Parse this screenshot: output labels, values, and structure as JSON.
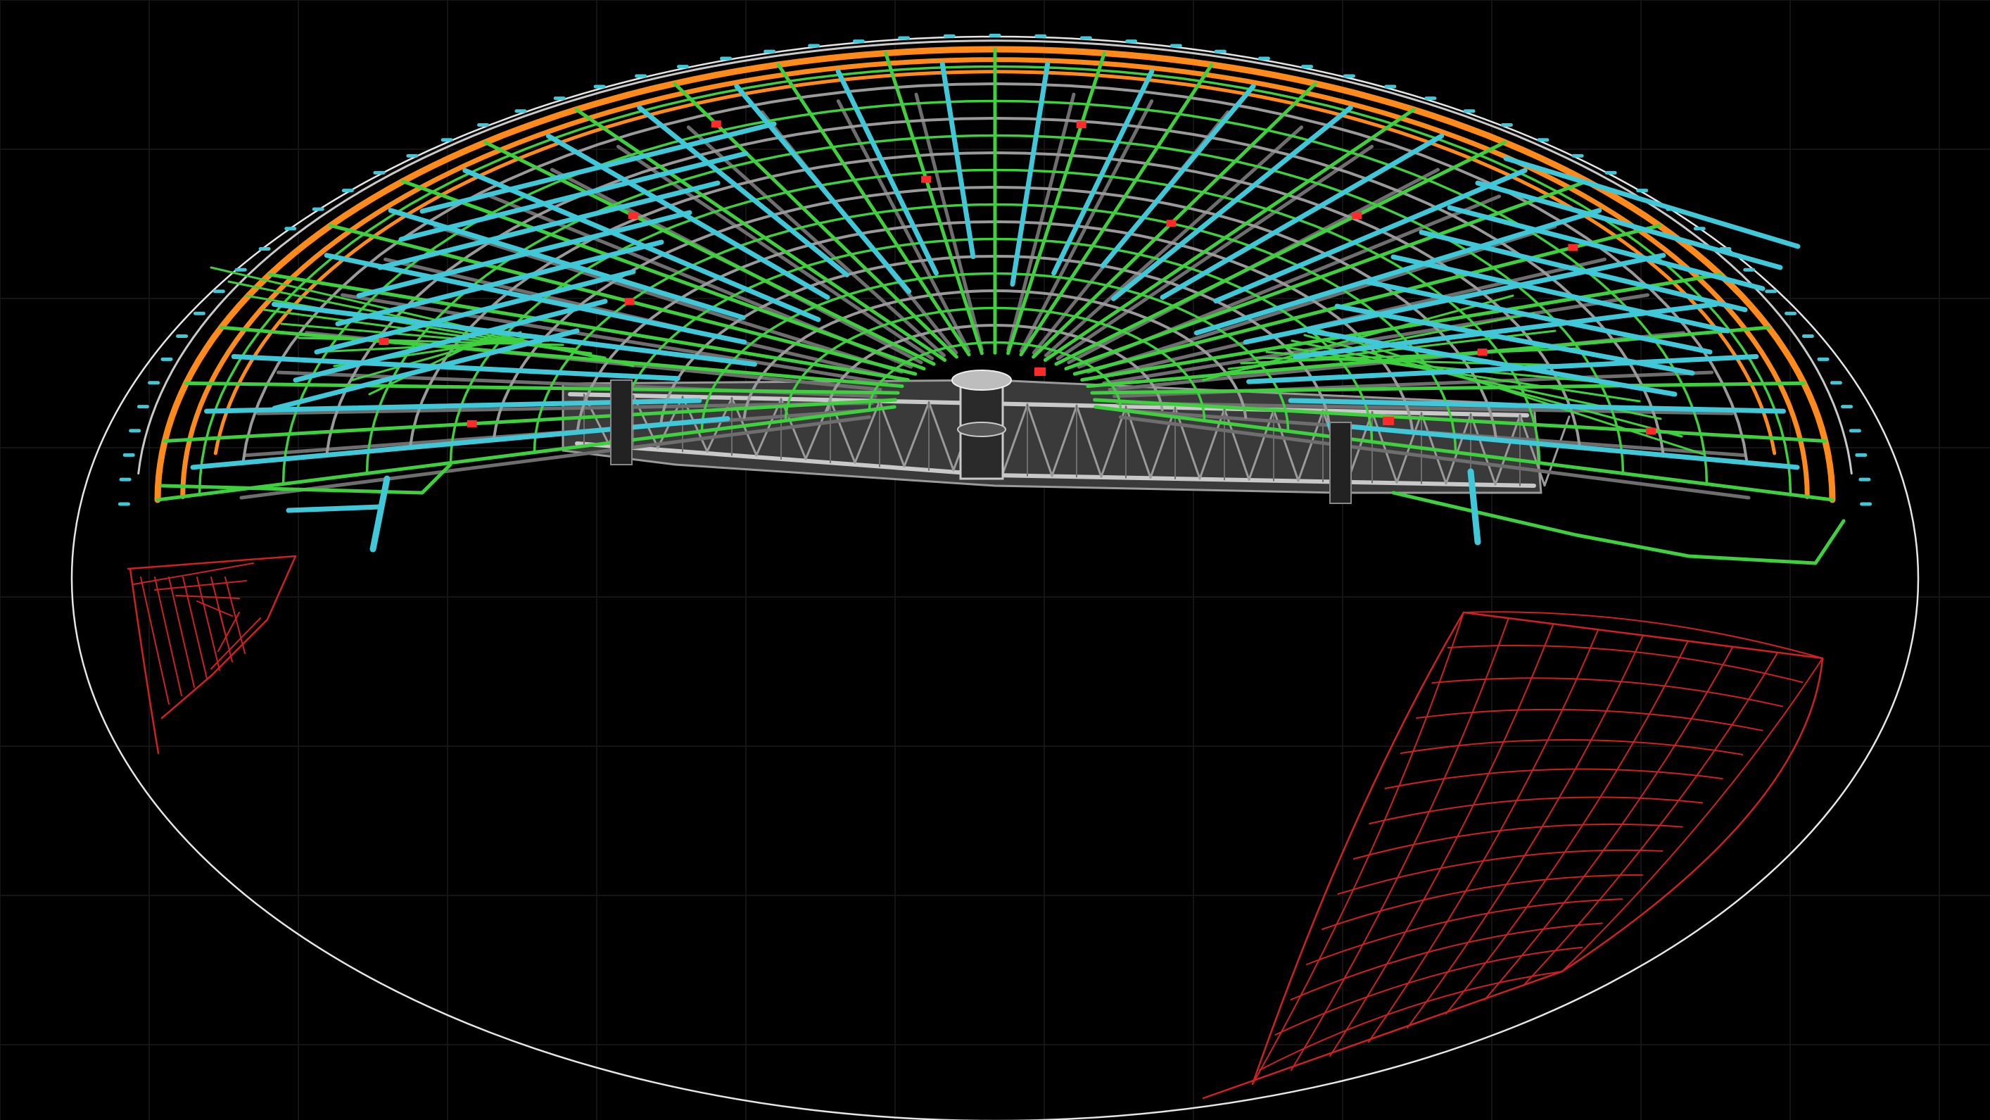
{
  "viewport": {
    "background": "#000000",
    "grid_visible": true
  },
  "colors": {
    "grid": "#1a1a1a",
    "boundary": "#e6e6e6",
    "steel_member": "#9a9a9a",
    "steel_member_light": "#c9c9c9",
    "steel_panel": "#6e6e6e",
    "outer_ring": "#ff8a1c",
    "radial_rib": "#3fcf3f",
    "purlin": "#40c8d8",
    "connection_node": "#ff2a2a",
    "section_curve": "#d02020"
  },
  "legend": {
    "items": [
      {
        "key": "boundary",
        "icon": "ellipse-boundary-icon"
      },
      {
        "key": "outer_ring",
        "icon": "ring-beam-icon"
      },
      {
        "key": "radial_rib",
        "icon": "rib-icon"
      },
      {
        "key": "purlin",
        "icon": "purlin-icon"
      },
      {
        "key": "connection_node",
        "icon": "node-icon"
      },
      {
        "key": "section_curve",
        "icon": "section-curve-icon"
      }
    ]
  }
}
